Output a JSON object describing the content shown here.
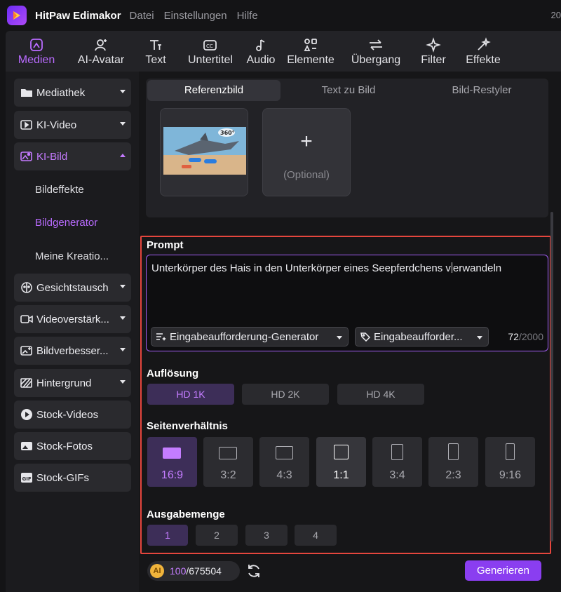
{
  "app": {
    "name": "HitPaw Edimakor",
    "title_right": "20"
  },
  "menu": [
    "Datei",
    "Einstellungen",
    "Hilfe"
  ],
  "colors": {
    "accent": "#b96bff",
    "highlight": "#e5463d",
    "generate": "#8a3ef0"
  },
  "toolbar": [
    {
      "label": "Medien",
      "icon": "media-icon",
      "active": true
    },
    {
      "label": "AI-Avatar",
      "icon": "avatar-icon"
    },
    {
      "label": "Text",
      "icon": "text-icon"
    },
    {
      "label": "Untertitel",
      "icon": "subtitle-icon"
    },
    {
      "label": "Audio",
      "icon": "audio-icon"
    },
    {
      "label": "Elemente",
      "icon": "elements-icon"
    },
    {
      "label": "Übergang",
      "icon": "transition-icon"
    },
    {
      "label": "Filter",
      "icon": "filter-icon"
    },
    {
      "label": "Effekte",
      "icon": "effects-icon"
    }
  ],
  "sidebar": {
    "items": [
      {
        "label": "Mediathek",
        "icon": "folder-icon"
      },
      {
        "label": "KI-Video",
        "icon": "ai-video-icon"
      },
      {
        "label": "KI-Bild",
        "icon": "ai-image-icon",
        "expanded": true
      },
      {
        "label": "Gesichtstausch",
        "icon": "face-swap-icon"
      },
      {
        "label": "Videoverstärk...",
        "icon": "video-enhance-icon"
      },
      {
        "label": "Bildverbesser...",
        "icon": "image-enhance-icon"
      },
      {
        "label": "Hintergrund",
        "icon": "background-icon"
      },
      {
        "label": "Stock-Videos",
        "icon": "play-icon"
      },
      {
        "label": "Stock-Fotos",
        "icon": "photo-icon"
      },
      {
        "label": "Stock-GIFs",
        "icon": "gif-icon"
      }
    ],
    "sub_items": [
      "Bildeffekte",
      "Bildgenerator",
      "Meine Kreatio..."
    ]
  },
  "tabs": [
    "Referenzbild",
    "Text zu Bild",
    "Bild-Restyler"
  ],
  "reference": {
    "optional_label": "(Optional)",
    "thumb_badge": "360°"
  },
  "prompt": {
    "label": "Prompt",
    "text_before_cursor": "Unterkörper des Hais in den Unterkörper eines Seepferdchens v",
    "text_after_cursor": "erwandeln",
    "generator_button": "Eingabeaufforderung-Generator",
    "library_button": "Eingabeaufforder...",
    "count": "72",
    "max": "/2000"
  },
  "resolution": {
    "label": "Auflösung",
    "options": [
      "HD 1K",
      "HD 2K",
      "HD 4K"
    ],
    "selected": 0
  },
  "aspect": {
    "label": "Seitenverhältnis",
    "options": [
      "16:9",
      "3:2",
      "4:3",
      "1:1",
      "3:4",
      "2:3",
      "9:16"
    ],
    "selected": 0
  },
  "output": {
    "label": "Ausgabemenge",
    "options": [
      "1",
      "2",
      "3",
      "4"
    ],
    "selected": 0
  },
  "footer": {
    "credits_current": "100",
    "credits_total": "/675504",
    "generate_label": "Generieren",
    "coin_letter": "AI"
  }
}
